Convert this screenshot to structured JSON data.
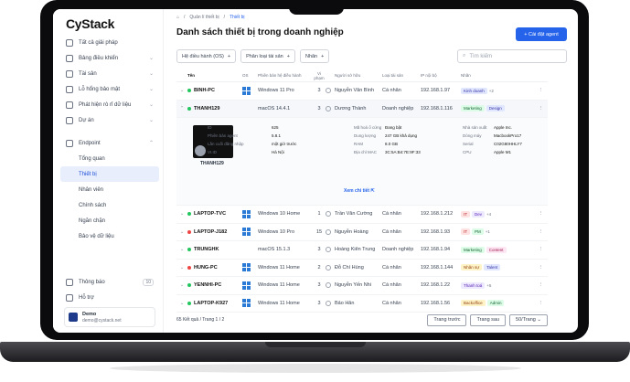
{
  "app": {
    "logo": "CyStack"
  },
  "sidebar": {
    "items": [
      {
        "label": "Tất cả giải pháp",
        "chev": ""
      },
      {
        "label": "Bảng điều khiển",
        "chev": "⌄"
      },
      {
        "label": "Tài sản",
        "chev": "⌄"
      },
      {
        "label": "Lỗ hổng bảo mật",
        "chev": "⌄"
      },
      {
        "label": "Phát hiện rò rỉ dữ liệu",
        "chev": "⌄"
      },
      {
        "label": "Dự án",
        "chev": "⌄"
      },
      {
        "label": "Endpoint",
        "chev": "⌃"
      }
    ],
    "sub": [
      {
        "label": "Tổng quan"
      },
      {
        "label": "Thiết bị"
      },
      {
        "label": "Nhân viên"
      },
      {
        "label": "Chính sách"
      },
      {
        "label": "Ngăn chặn"
      },
      {
        "label": "Bảo vệ dữ liệu"
      }
    ],
    "notify_label": "Thông báo",
    "notify_count": "10",
    "help_label": "Hỗ trợ",
    "user": {
      "name": "Demo",
      "email": "demo@cystack.net"
    }
  },
  "breadcrumb": {
    "parent": "Quản lí thiết bị",
    "current": "Thiết bị",
    "sep": "/"
  },
  "page": {
    "title": "Danh sách thiết bị trong doanh nghiệp",
    "add_button": "+ Cài đặt agent"
  },
  "filters": {
    "os": "Hệ điều hành (OS)",
    "asset": "Phân loại tài sản",
    "label": "Nhãn",
    "plus": "+"
  },
  "search": {
    "placeholder": "Tìm kiếm"
  },
  "table": {
    "headers": [
      "Tên",
      "OS",
      "Phiên bản hệ điều hành",
      "Vi phạm",
      "",
      "Người sở hữu",
      "Loại tài sản",
      "IP nội bộ",
      "Nhãn",
      ""
    ],
    "rows": [
      {
        "name": "BINH-PC",
        "status": "#22c55e",
        "os": "windows",
        "ver": "Windows 11 Pro",
        "vio": "3",
        "owner": "Nguyễn Văn Bình",
        "type": "Cá nhân",
        "ip": "192.168.1.97",
        "tags": [
          {
            "t": "Kinh doanh",
            "c": "#e0e7ff",
            "f": "#3730a3"
          }
        ],
        "more": "+2"
      },
      {
        "name": "THANH129",
        "status": "#22c55e",
        "os": "mac",
        "ver": "macOS 14.4.1",
        "vio": "3",
        "owner": "Dương Thành",
        "type": "Doanh nghiệp",
        "ip": "192.168.1.116",
        "tags": [
          {
            "t": "Marketing",
            "c": "#dcfce7",
            "f": "#166534"
          },
          {
            "t": "Design",
            "c": "#e0e7ff",
            "f": "#3730a3"
          }
        ],
        "more": ""
      },
      {
        "name": "LAPTOP-TVC",
        "status": "#22c55e",
        "os": "windows",
        "ver": "Windows 10 Home",
        "vio": "1",
        "owner": "Trần Văn Cường",
        "type": "Cá nhân",
        "ip": "192.168.1.212",
        "tags": [
          {
            "t": "IT",
            "c": "#fee2e2",
            "f": "#b91c1c"
          },
          {
            "t": "Dev",
            "c": "#ede9fe",
            "f": "#5b21b6"
          }
        ],
        "more": "+4"
      },
      {
        "name": "LAPTOP-J182",
        "status": "#ef4444",
        "os": "windows",
        "ver": "Windows 10 Pro",
        "vio": "15",
        "owner": "Nguyễn Hoàng",
        "type": "Cá nhân",
        "ip": "192.168.1.93",
        "tags": [
          {
            "t": "IT",
            "c": "#fee2e2",
            "f": "#b91c1c"
          },
          {
            "t": "PM",
            "c": "#dcfce7",
            "f": "#166534"
          }
        ],
        "more": "+1"
      },
      {
        "name": "TRUNGHK",
        "status": "#22c55e",
        "os": "mac",
        "ver": "macOS 15.1.3",
        "vio": "3",
        "owner": "Hoàng Kiên Trung",
        "type": "Doanh nghiệp",
        "ip": "192.168.1.94",
        "tags": [
          {
            "t": "Marketing",
            "c": "#dcfce7",
            "f": "#166534"
          },
          {
            "t": "Content",
            "c": "#fce7f3",
            "f": "#9d174d"
          }
        ],
        "more": ""
      },
      {
        "name": "HUNG-PC",
        "status": "#ef4444",
        "os": "windows",
        "ver": "Windows 11 Home",
        "vio": "2",
        "owner": "Đỗ Chí Hùng",
        "type": "Cá nhân",
        "ip": "192.168.1.144",
        "tags": [
          {
            "t": "Nhân sự",
            "c": "#fef3c7",
            "f": "#92400e"
          },
          {
            "t": "Talent",
            "c": "#e0e7ff",
            "f": "#3730a3"
          }
        ],
        "more": ""
      },
      {
        "name": "YENNHI-PC",
        "status": "#22c55e",
        "os": "windows",
        "ver": "Windows 11 Home",
        "vio": "3",
        "owner": "Nguyễn Yến Nhi",
        "type": "Cá nhân",
        "ip": "192.168.1.22",
        "tags": [
          {
            "t": "Thanh toá",
            "c": "#ede9fe",
            "f": "#5b21b6"
          }
        ],
        "more": "+5"
      },
      {
        "name": "LAPTOP-K927",
        "status": "#22c55e",
        "os": "windows",
        "ver": "Windows 11 Home",
        "vio": "3",
        "owner": "Bảo Hân",
        "type": "Cá nhân",
        "ip": "192.168.1.56",
        "tags": [
          {
            "t": "Backoffice",
            "c": "#fef3c7",
            "f": "#92400e"
          },
          {
            "t": "Admin",
            "c": "#dcfce7",
            "f": "#166534"
          }
        ],
        "more": ""
      }
    ],
    "detail": {
      "caption": "THANH129",
      "col1": [
        [
          "ID",
          "625"
        ],
        [
          "Phiên bản agent",
          "5.8.1"
        ],
        [
          "Lần cuối đăng nhập",
          "một giờ trước"
        ],
        [
          "VI.ID",
          "Hà Nội"
        ]
      ],
      "col2": [
        [
          "Mã hoá ổ cứng",
          "Đang bật"
        ],
        [
          "Dung lượng",
          "247 GB khả dụng"
        ],
        [
          "RAM",
          "8.0 GB"
        ],
        [
          "Địa chỉ MAC",
          "3C:5A:B4:7E:9F:33"
        ]
      ],
      "col3": [
        [
          "Nhà sản xuất",
          "Apple Inc."
        ],
        [
          "Dòng máy",
          "MacbookPro17"
        ],
        [
          "Serial",
          "C02G80HHLY7"
        ],
        [
          "CPU",
          "Apple M1"
        ]
      ],
      "more_link": "Xem chi tiết ⇱"
    }
  },
  "pagination": {
    "summary": "65 Kết quả / Trang 1 / 2",
    "prev": "Trang trước",
    "next": "Trang sau",
    "size": "50/Trang ⌄"
  }
}
